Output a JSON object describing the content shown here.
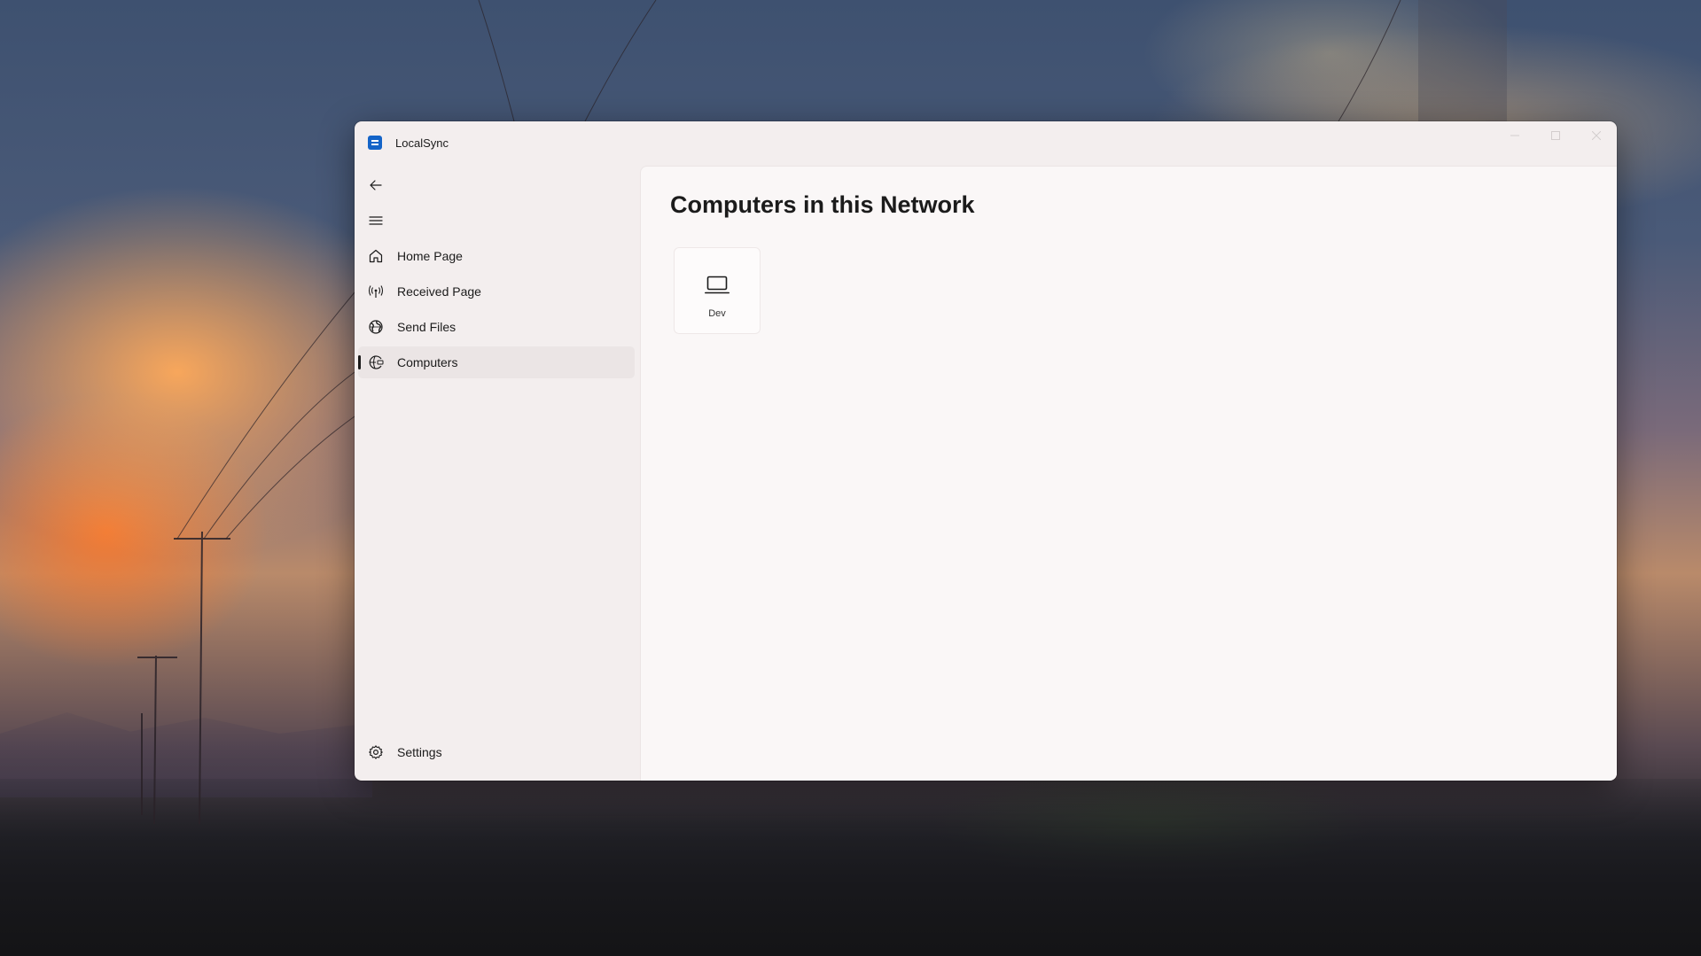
{
  "app": {
    "title": "LocalSync"
  },
  "nav": {
    "items": [
      {
        "label": "Home Page",
        "icon": "home-icon"
      },
      {
        "label": "Received Page",
        "icon": "antenna-icon"
      },
      {
        "label": "Send Files",
        "icon": "globe-icon"
      },
      {
        "label": "Computers",
        "icon": "network-icon",
        "selected": true
      }
    ],
    "footer": {
      "label": "Settings",
      "icon": "gear-icon"
    }
  },
  "main": {
    "title": "Computers in this Network",
    "devices": [
      {
        "name": "Dev",
        "icon": "laptop-icon"
      }
    ]
  },
  "colors": {
    "accent": "#1464c8",
    "window_bg": "#f3eeee",
    "content_bg": "#faf7f7",
    "selected_bg": "#ebe5e5"
  }
}
